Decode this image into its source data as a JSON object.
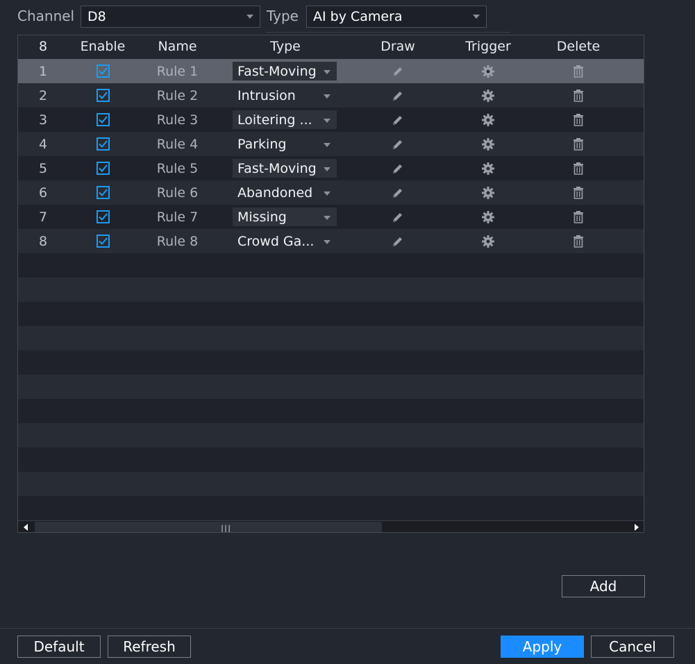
{
  "filters": {
    "channel_label": "Channel",
    "channel_value": "D8",
    "type_label": "Type",
    "type_value": "AI by Camera"
  },
  "table": {
    "headers": {
      "count": "8",
      "enable": "Enable",
      "name": "Name",
      "type": "Type",
      "draw": "Draw",
      "trigger": "Trigger",
      "delete": "Delete"
    },
    "rows": [
      {
        "num": "1",
        "enabled": true,
        "name": "Rule 1",
        "type": "Fast-Moving",
        "selected": true
      },
      {
        "num": "2",
        "enabled": true,
        "name": "Rule 2",
        "type": "Intrusion"
      },
      {
        "num": "3",
        "enabled": true,
        "name": "Rule 3",
        "type": "Loitering ..."
      },
      {
        "num": "4",
        "enabled": true,
        "name": "Rule 4",
        "type": "Parking"
      },
      {
        "num": "5",
        "enabled": true,
        "name": "Rule 5",
        "type": "Fast-Moving"
      },
      {
        "num": "6",
        "enabled": true,
        "name": "Rule 6",
        "type": "Abandoned"
      },
      {
        "num": "7",
        "enabled": true,
        "name": "Rule 7",
        "type": "Missing"
      },
      {
        "num": "8",
        "enabled": true,
        "name": "Rule 8",
        "type": "Crowd Ga..."
      }
    ],
    "icons": {
      "draw": "pencil-icon",
      "trigger": "gear-icon",
      "delete": "trash-icon",
      "enable": "checkbox-checked-icon"
    },
    "scrollbar_grip": "|||"
  },
  "buttons": {
    "add": "Add",
    "default": "Default",
    "refresh": "Refresh",
    "apply": "Apply",
    "cancel": "Cancel"
  },
  "colors": {
    "background": "#232730",
    "accent": "#1a8cff",
    "checkbox": "#1d9bf0",
    "selected_row": "#5d626c"
  }
}
